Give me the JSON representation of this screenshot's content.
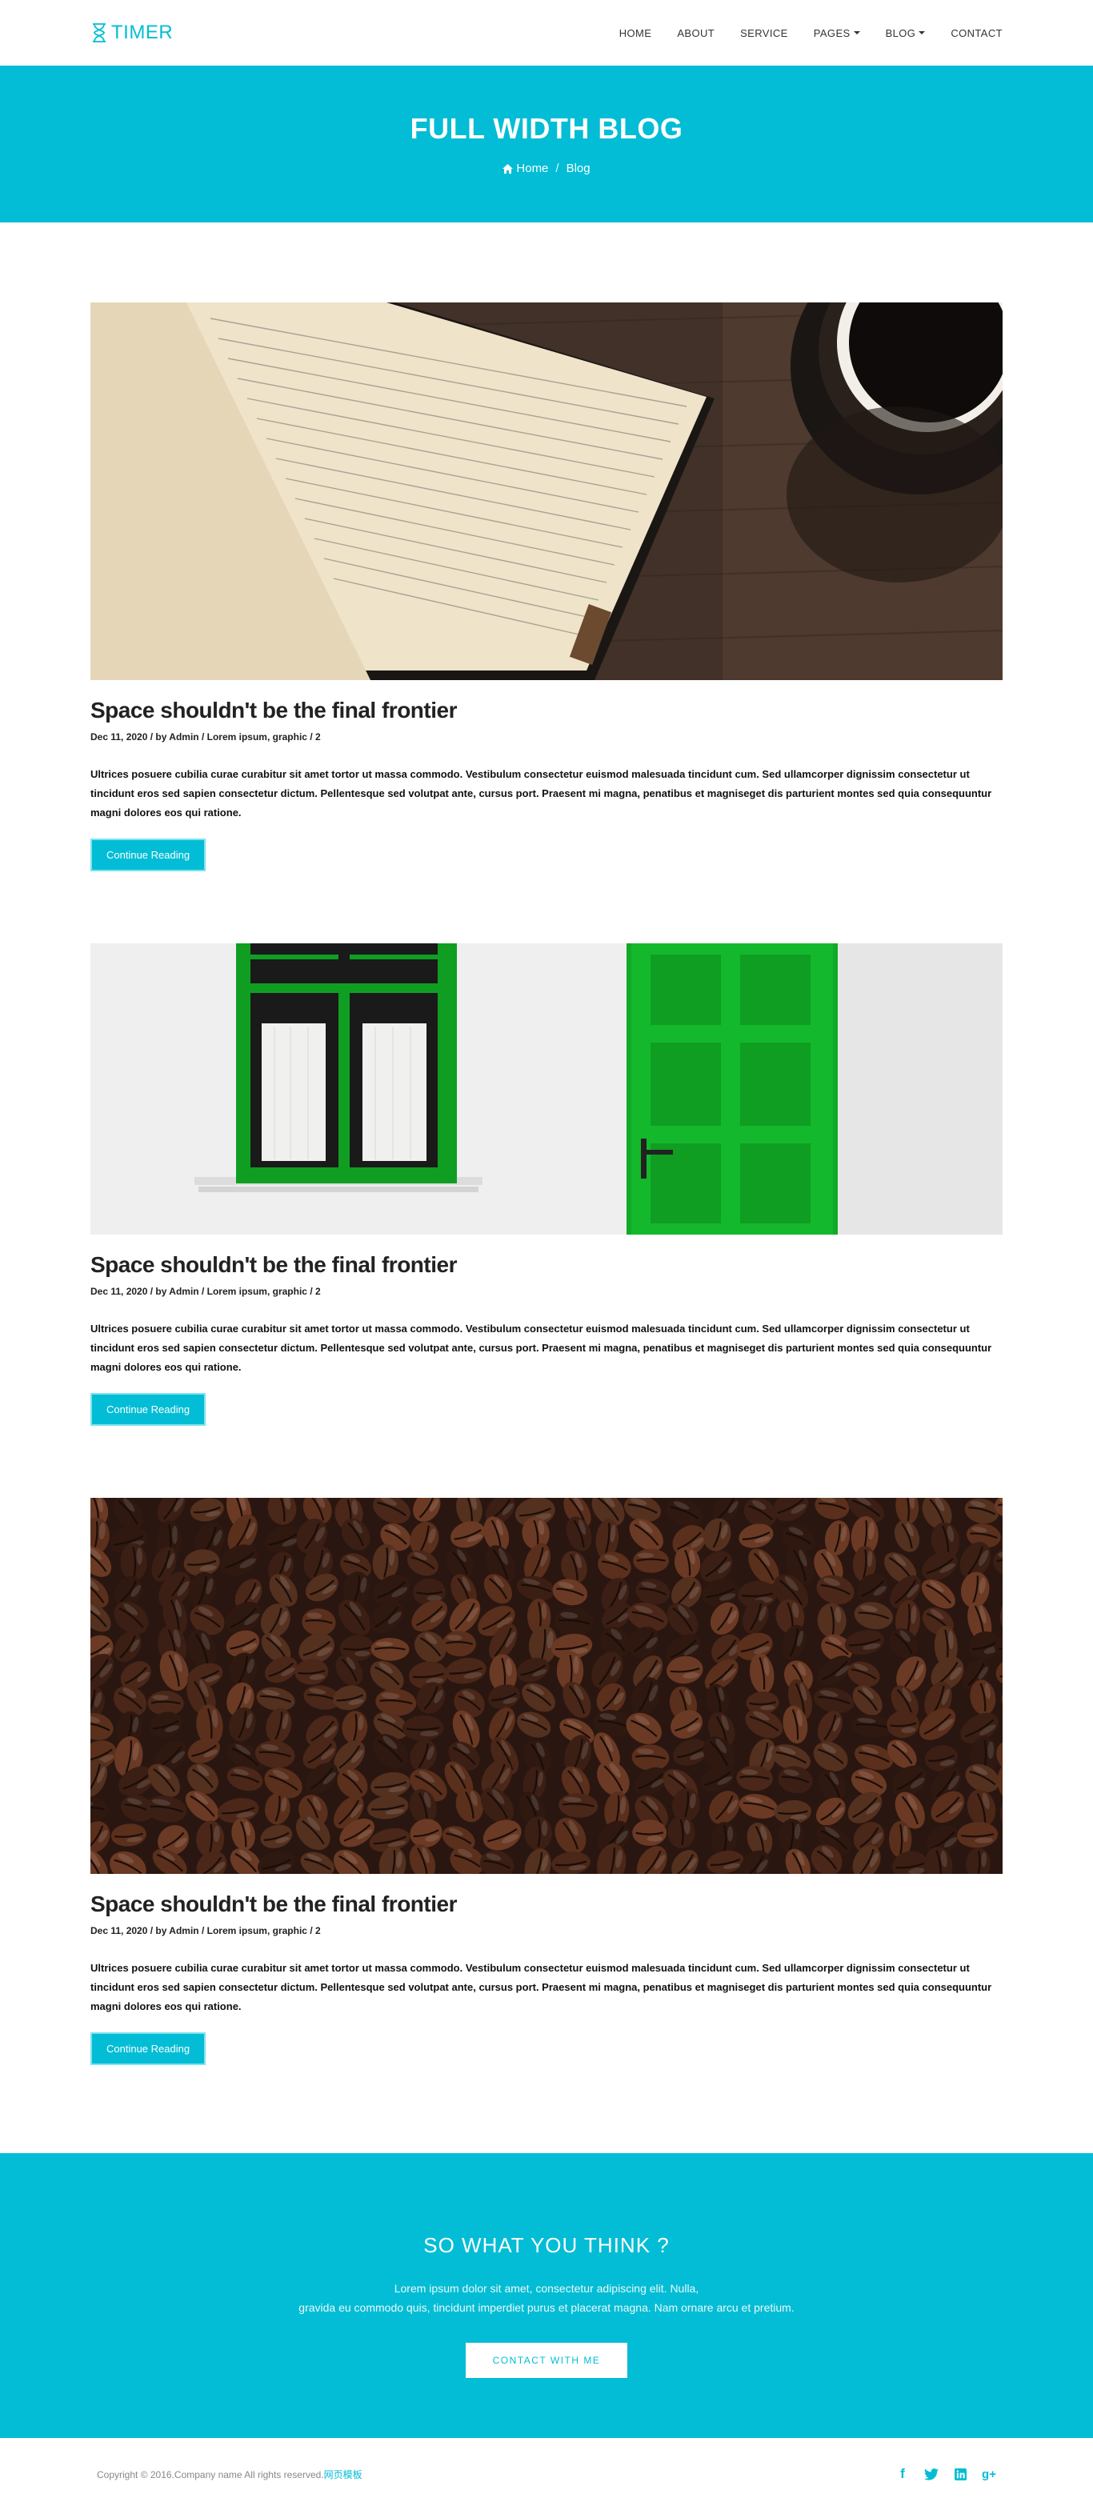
{
  "brand": {
    "name": "TIMER",
    "color": "#02bdd5"
  },
  "nav": {
    "items": [
      {
        "label": "HOME",
        "dropdown": false
      },
      {
        "label": "ABOUT",
        "dropdown": false
      },
      {
        "label": "SERVICE",
        "dropdown": false
      },
      {
        "label": "PAGES",
        "dropdown": true
      },
      {
        "label": "BLOG",
        "dropdown": true
      },
      {
        "label": "CONTACT",
        "dropdown": false
      }
    ]
  },
  "hero": {
    "title": "FULL WIDTH BLOG",
    "breadcrumb_home": "Home",
    "breadcrumb_separator": "/",
    "breadcrumb_current": "Blog"
  },
  "posts": [
    {
      "title": "Space shouldn't be the final frontier",
      "meta": "Dec 11, 2020 / by Admin / Lorem ipsum, graphic / 2",
      "excerpt": "Ultrices posuere cubilia curae curabitur sit amet tortor ut massa commodo. Vestibulum consectetur euismod malesuada tincidunt cum. Sed ullamcorper dignissim consectetur ut tincidunt eros sed sapien consectetur dictum. Pellentesque sed volutpat ante, cursus port. Praesent mi magna, penatibus et magniseget dis parturient montes sed quia consequuntur magni dolores eos qui ratione.",
      "button": "Continue Reading",
      "image": "notebook-coffee-photo"
    },
    {
      "title": "Space shouldn't be the final frontier",
      "meta": "Dec 11, 2020 / by Admin / Lorem ipsum, graphic / 2",
      "excerpt": "Ultrices posuere cubilia curae curabitur sit amet tortor ut massa commodo. Vestibulum consectetur euismod malesuada tincidunt cum. Sed ullamcorper dignissim consectetur ut tincidunt eros sed sapien consectetur dictum. Pellentesque sed volutpat ante, cursus port. Praesent mi magna, penatibus et magniseget dis parturient montes sed quia consequuntur magni dolores eos qui ratione.",
      "button": "Continue Reading",
      "image": "green-door-window-photo"
    },
    {
      "title": "Space shouldn't be the final frontier",
      "meta": "Dec 11, 2020 / by Admin / Lorem ipsum, graphic / 2",
      "excerpt": "Ultrices posuere cubilia curae curabitur sit amet tortor ut massa commodo. Vestibulum consectetur euismod malesuada tincidunt cum. Sed ullamcorper dignissim consectetur ut tincidunt eros sed sapien consectetur dictum. Pellentesque sed volutpat ante, cursus port. Praesent mi magna, penatibus et magniseget dis parturient montes sed quia consequuntur magni dolores eos qui ratione.",
      "button": "Continue Reading",
      "image": "coffee-beans-photo"
    }
  ],
  "cta": {
    "title": "SO WHAT YOU THINK ?",
    "line1": "Lorem ipsum dolor sit amet, consectetur adipiscing elit. Nulla,",
    "line2": "gravida eu commodo quis, tincidunt imperdiet purus et placerat magna. Nam ornare arcu et pretium.",
    "button": "CONTACT WITH ME"
  },
  "footer": {
    "copyright": "Copyright © 2016.Company name All rights reserved.",
    "link": "网页模板",
    "social": [
      "facebook-icon",
      "twitter-icon",
      "linkedin-icon",
      "google-plus-icon"
    ]
  }
}
